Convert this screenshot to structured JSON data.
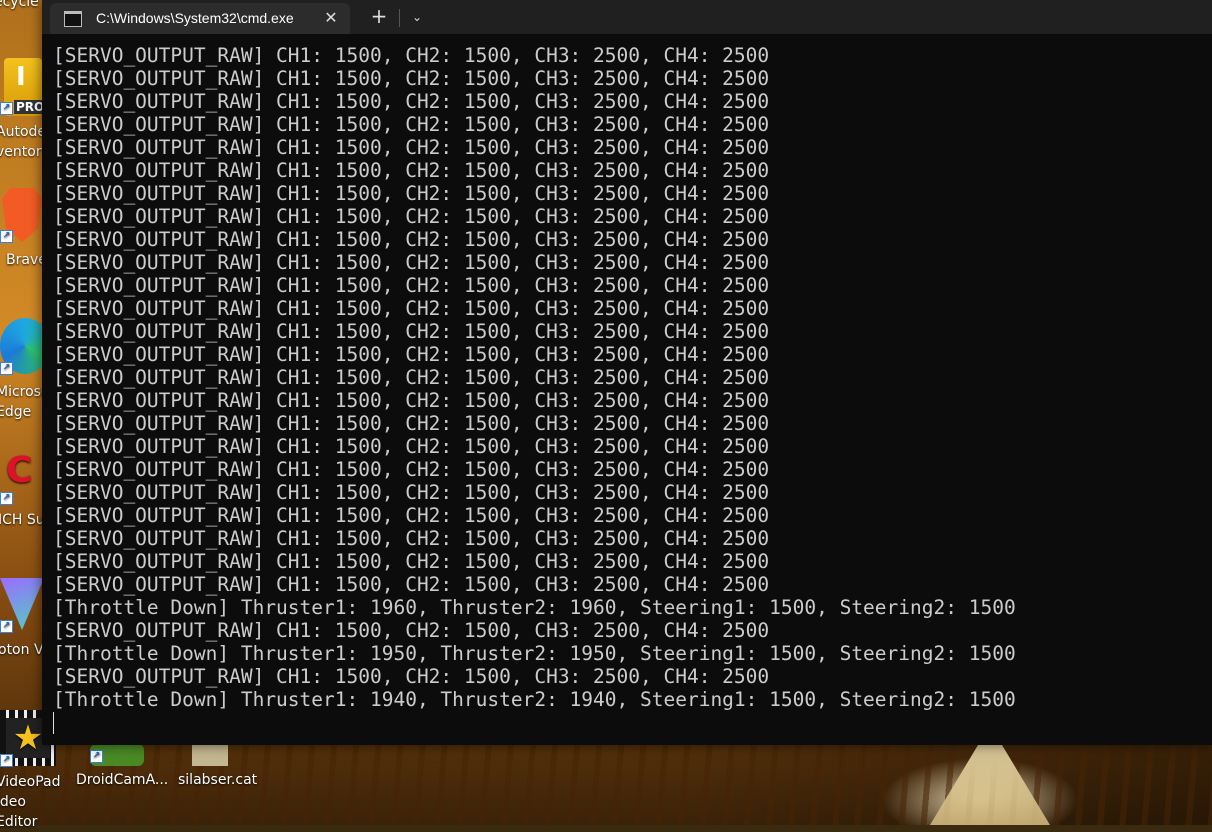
{
  "window": {
    "tab_title": "C:\\Windows\\System32\\cmd.exe",
    "new_tab_symbol": "+",
    "close_symbol": "✕",
    "menu_symbol": "⌄"
  },
  "desktop": {
    "icons": [
      {
        "label": "ecycle"
      },
      {
        "label": "Autode ventor"
      },
      {
        "label": "Brave"
      },
      {
        "label": "Microsc Edge"
      },
      {
        "label": "ICH Su"
      },
      {
        "label": "oton V"
      },
      {
        "label": "VideoPad ideo Editor"
      },
      {
        "label": "DroidCamA..."
      },
      {
        "label": "silabser.cat"
      }
    ],
    "icon_badge": "PRO"
  },
  "console": {
    "lines": [
      "[SERVO_OUTPUT_RAW] CH1: 1500, CH2: 1500, CH3: 2500, CH4: 2500",
      "[SERVO_OUTPUT_RAW] CH1: 1500, CH2: 1500, CH3: 2500, CH4: 2500",
      "[SERVO_OUTPUT_RAW] CH1: 1500, CH2: 1500, CH3: 2500, CH4: 2500",
      "[SERVO_OUTPUT_RAW] CH1: 1500, CH2: 1500, CH3: 2500, CH4: 2500",
      "[SERVO_OUTPUT_RAW] CH1: 1500, CH2: 1500, CH3: 2500, CH4: 2500",
      "[SERVO_OUTPUT_RAW] CH1: 1500, CH2: 1500, CH3: 2500, CH4: 2500",
      "[SERVO_OUTPUT_RAW] CH1: 1500, CH2: 1500, CH3: 2500, CH4: 2500",
      "[SERVO_OUTPUT_RAW] CH1: 1500, CH2: 1500, CH3: 2500, CH4: 2500",
      "[SERVO_OUTPUT_RAW] CH1: 1500, CH2: 1500, CH3: 2500, CH4: 2500",
      "[SERVO_OUTPUT_RAW] CH1: 1500, CH2: 1500, CH3: 2500, CH4: 2500",
      "[SERVO_OUTPUT_RAW] CH1: 1500, CH2: 1500, CH3: 2500, CH4: 2500",
      "[SERVO_OUTPUT_RAW] CH1: 1500, CH2: 1500, CH3: 2500, CH4: 2500",
      "[SERVO_OUTPUT_RAW] CH1: 1500, CH2: 1500, CH3: 2500, CH4: 2500",
      "[SERVO_OUTPUT_RAW] CH1: 1500, CH2: 1500, CH3: 2500, CH4: 2500",
      "[SERVO_OUTPUT_RAW] CH1: 1500, CH2: 1500, CH3: 2500, CH4: 2500",
      "[SERVO_OUTPUT_RAW] CH1: 1500, CH2: 1500, CH3: 2500, CH4: 2500",
      "[SERVO_OUTPUT_RAW] CH1: 1500, CH2: 1500, CH3: 2500, CH4: 2500",
      "[SERVO_OUTPUT_RAW] CH1: 1500, CH2: 1500, CH3: 2500, CH4: 2500",
      "[SERVO_OUTPUT_RAW] CH1: 1500, CH2: 1500, CH3: 2500, CH4: 2500",
      "[SERVO_OUTPUT_RAW] CH1: 1500, CH2: 1500, CH3: 2500, CH4: 2500",
      "[SERVO_OUTPUT_RAW] CH1: 1500, CH2: 1500, CH3: 2500, CH4: 2500",
      "[SERVO_OUTPUT_RAW] CH1: 1500, CH2: 1500, CH3: 2500, CH4: 2500",
      "[SERVO_OUTPUT_RAW] CH1: 1500, CH2: 1500, CH3: 2500, CH4: 2500",
      "[SERVO_OUTPUT_RAW] CH1: 1500, CH2: 1500, CH3: 2500, CH4: 2500",
      "[Throttle Down] Thruster1: 1960, Thruster2: 1960, Steering1: 1500, Steering2: 1500",
      "[SERVO_OUTPUT_RAW] CH1: 1500, CH2: 1500, CH3: 2500, CH4: 2500",
      "[Throttle Down] Thruster1: 1950, Thruster2: 1950, Steering1: 1500, Steering2: 1500",
      "[SERVO_OUTPUT_RAW] CH1: 1500, CH2: 1500, CH3: 2500, CH4: 2500",
      "[Throttle Down] Thruster1: 1940, Thruster2: 1940, Steering1: 1500, Steering2: 1500"
    ]
  }
}
